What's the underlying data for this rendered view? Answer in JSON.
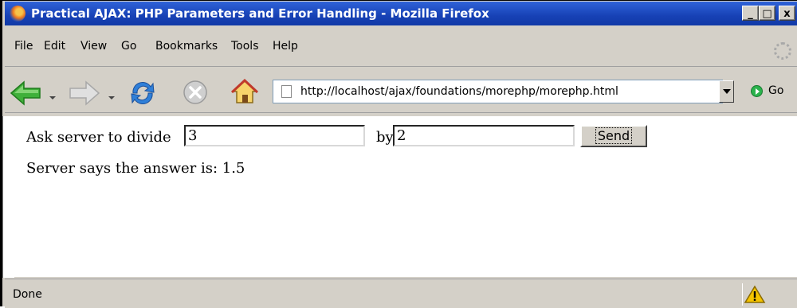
{
  "window": {
    "title": "Practical AJAX: PHP Parameters and Error Handling - Mozilla Firefox",
    "controls": {
      "minimize": "_",
      "maximize": "□",
      "close": "x"
    }
  },
  "menu": {
    "items": [
      "File",
      "Edit",
      "View",
      "Go",
      "Bookmarks",
      "Tools",
      "Help"
    ]
  },
  "toolbar": {
    "address": "http://localhost/ajax/foundations/morephp/morephp.html",
    "go_label": "Go"
  },
  "page": {
    "prompt_label": "Ask server to divide",
    "first_number": "3",
    "by_label": "by",
    "second_number": "2",
    "send_label": "Send",
    "result_text": "Server says the answer is: 1.5"
  },
  "status": {
    "text": "Done"
  },
  "icons": {
    "app": "firefox-icon",
    "back": "back-arrow-icon",
    "forward": "forward-arrow-icon",
    "reload": "reload-icon",
    "stop": "stop-icon",
    "home": "home-icon",
    "page": "page-icon",
    "go": "go-icon",
    "warning": "warning-icon"
  },
  "colors": {
    "titlebar": "#1741b5",
    "chrome": "#d4d0c8",
    "nav_arrow": "#3fb03a",
    "reload": "#2f7fd8",
    "go": "#2bb24c",
    "warning": "#f5c400"
  }
}
